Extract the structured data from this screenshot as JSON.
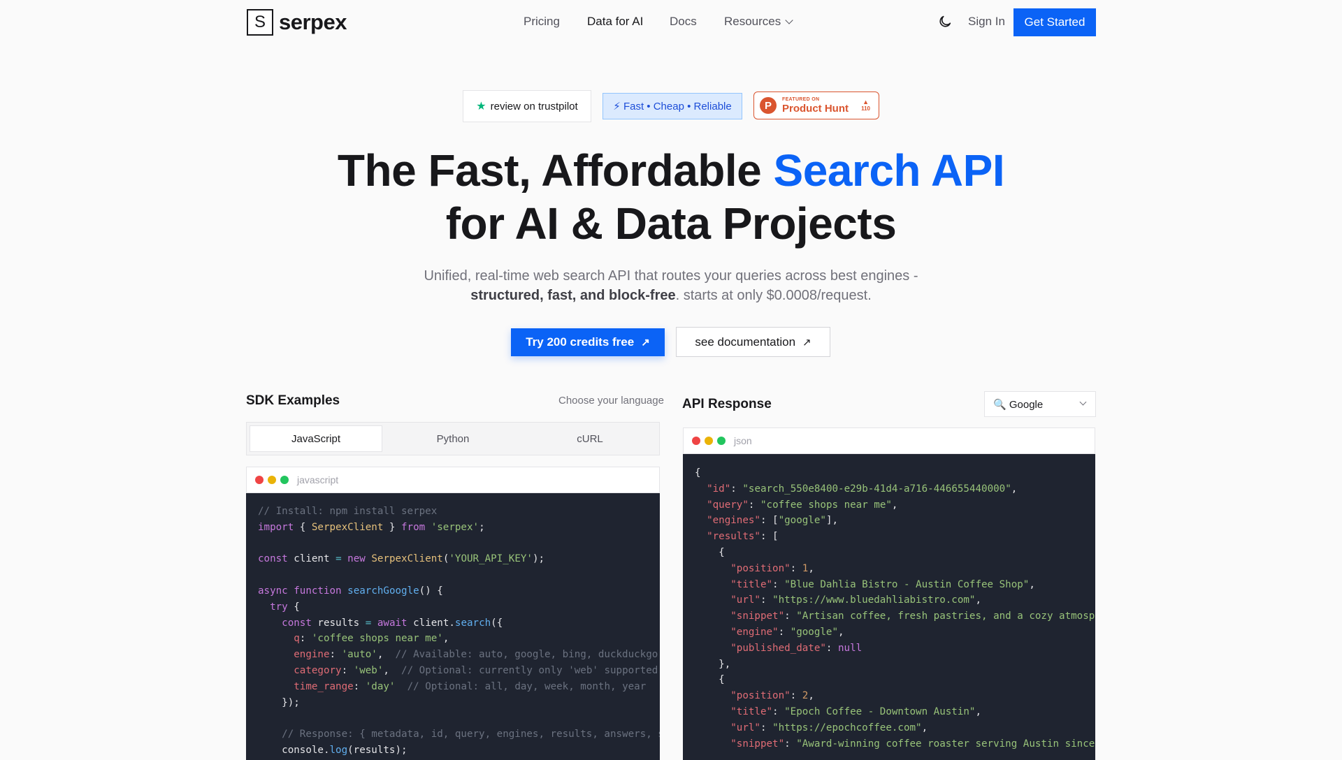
{
  "nav": {
    "logo_letter": "S",
    "logo_text": "serpex",
    "links": [
      "Pricing",
      "Data for AI",
      "Docs",
      "Resources"
    ],
    "sign_in": "Sign In",
    "get_started": "Get Started"
  },
  "badges": {
    "trustpilot": "review on trustpilot",
    "tagline": "⚡ Fast • Cheap • Reliable",
    "ph_featured": "FEATURED ON",
    "ph_name": "Product Hunt",
    "ph_votes": "110"
  },
  "hero": {
    "title_line1": "The Fast, Affordable ",
    "title_accent": "Search API",
    "title_line2": "for AI & Data Projects",
    "subtitle_line1": "Unified, real-time web search API that routes your queries across best engines -",
    "subtitle_bold": "structured, fast, and block-free",
    "subtitle_rest": ". starts at only $0.0008/request.",
    "cta_primary": "Try 200 credits free",
    "cta_secondary": "see documentation"
  },
  "sdk": {
    "title": "SDK Examples",
    "hint": "Choose your language",
    "tabs": [
      "JavaScript",
      "Python",
      "cURL"
    ],
    "active_tab": "JavaScript",
    "window_label": "javascript"
  },
  "api": {
    "title": "API Response",
    "engine_select": "🔍 Google",
    "window_label": "json"
  },
  "colors": {
    "accent": "#0b63f6",
    "code_bg": "#1f2430",
    "product_hunt": "#da552f",
    "trustpilot_star": "#00b67a"
  }
}
